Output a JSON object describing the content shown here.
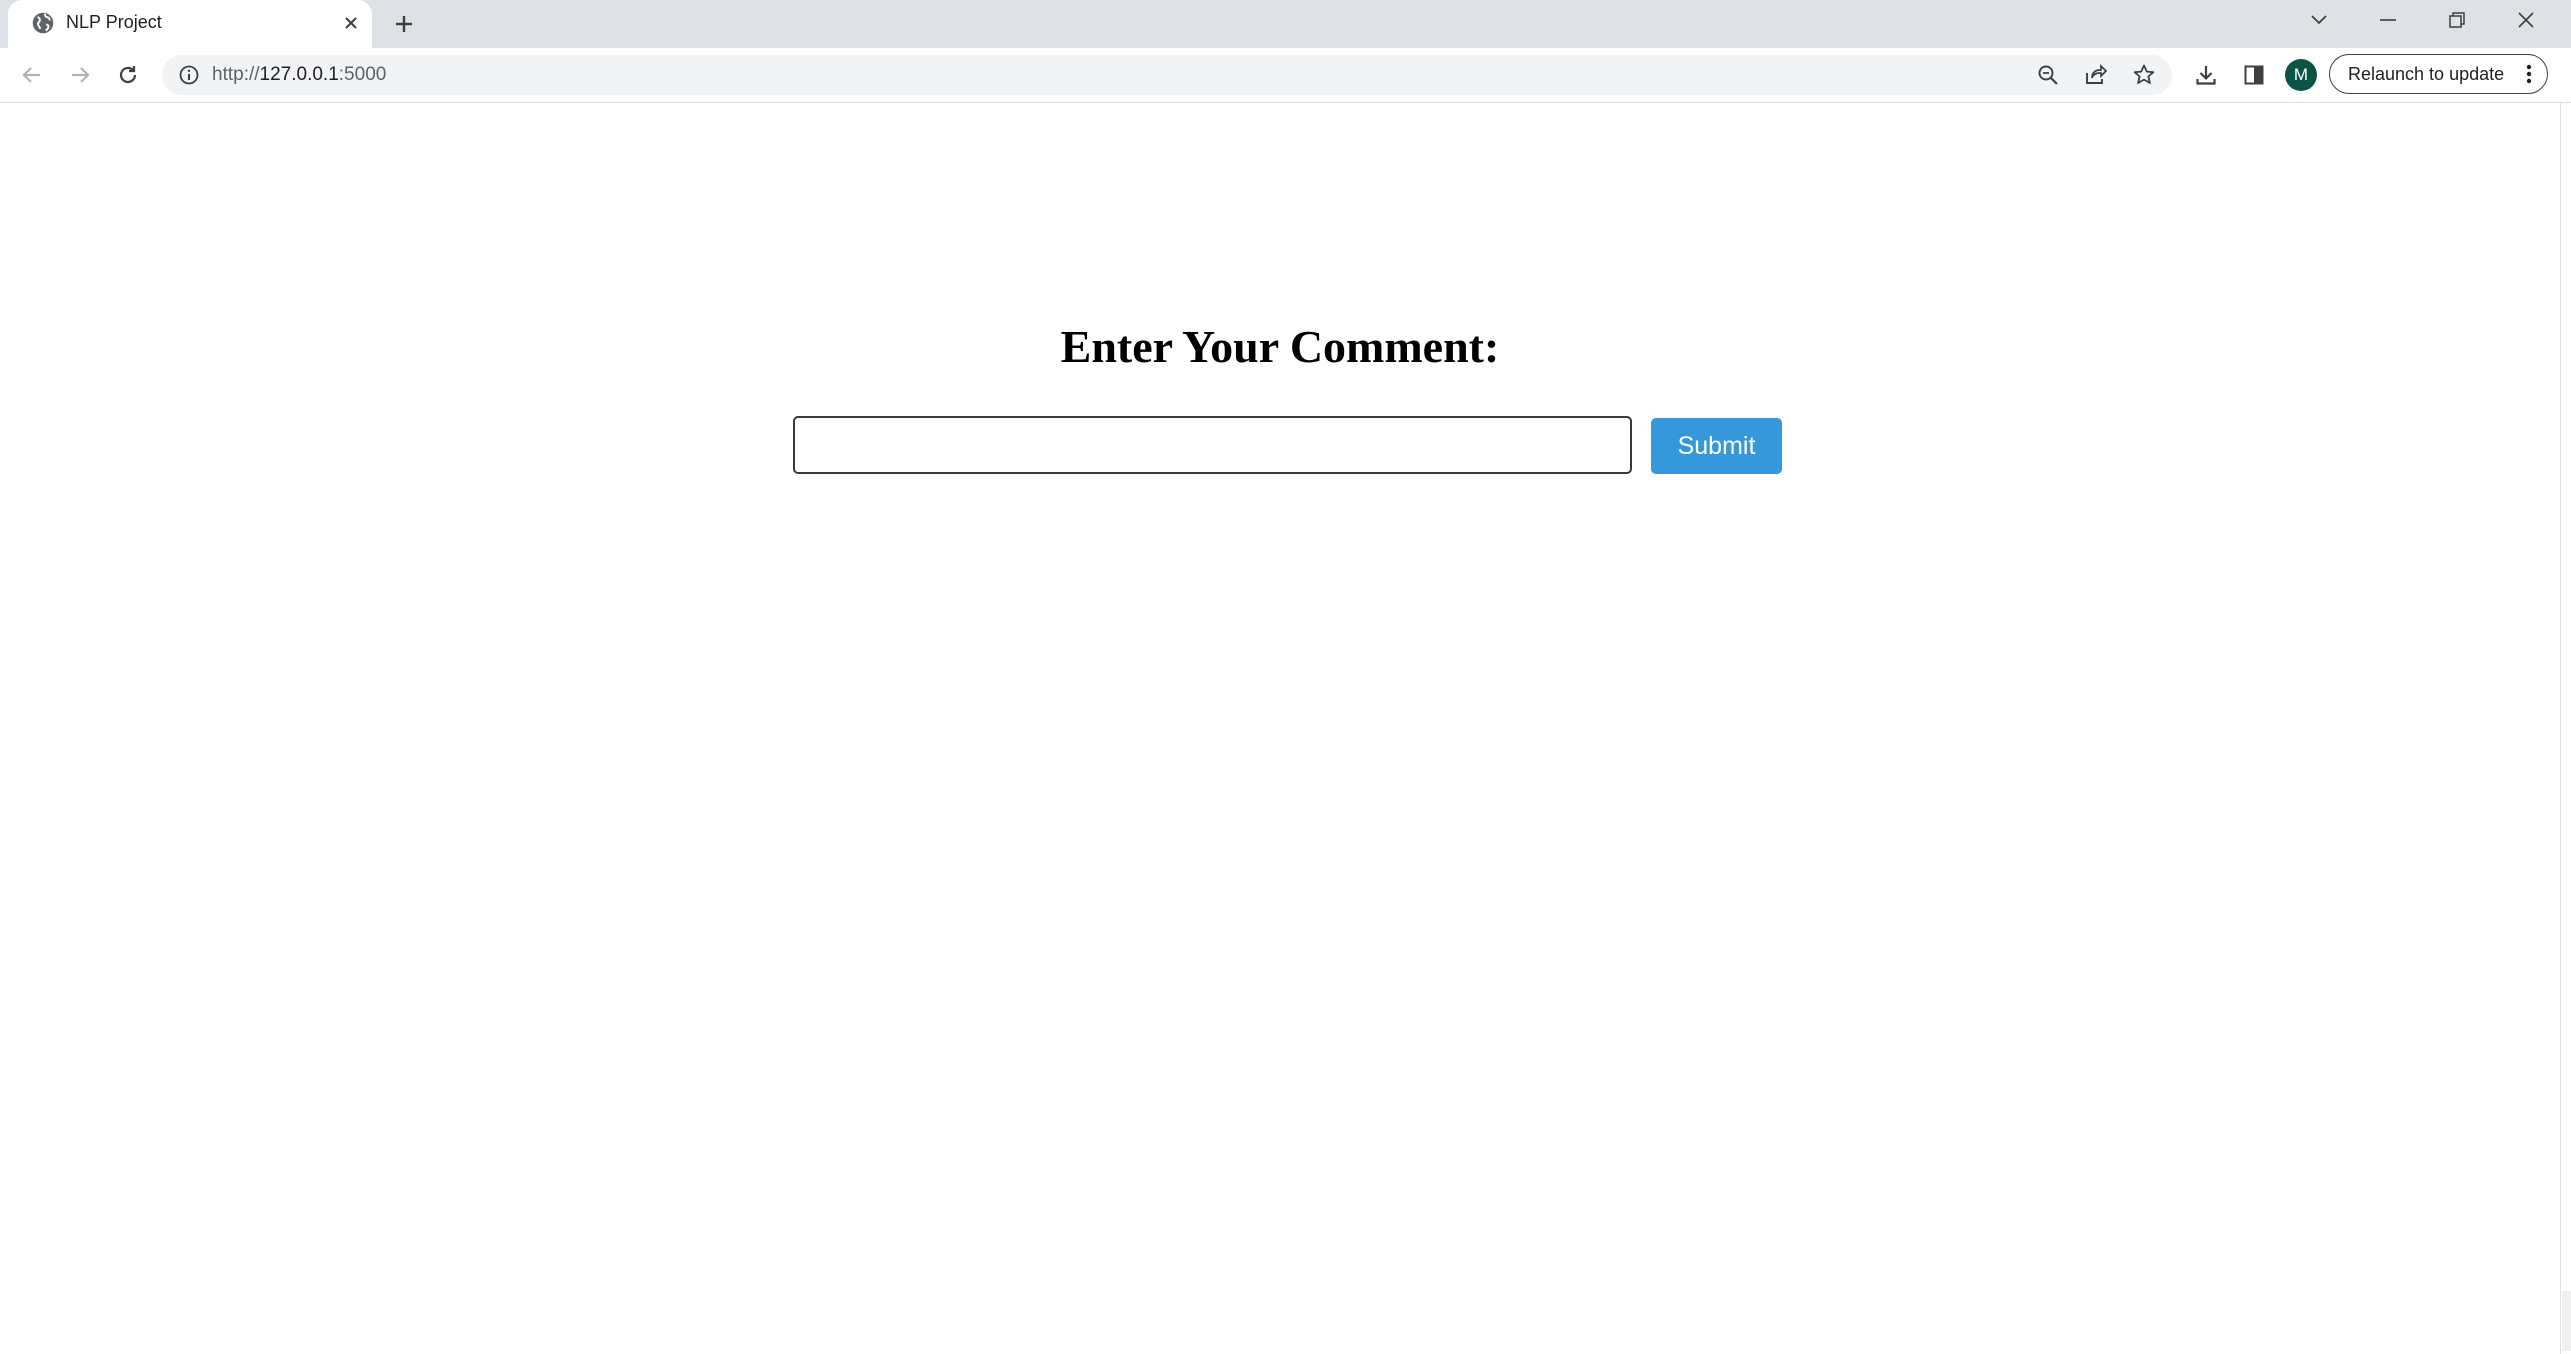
{
  "browser": {
    "tab": {
      "title": "NLP Project",
      "favicon": "globe-icon"
    },
    "new_tab_icon": "plus-icon",
    "window_controls": [
      "tab-search-icon",
      "minimize-icon",
      "restore-icon",
      "close-icon"
    ],
    "toolbar": {
      "back_icon": "back-arrow-icon",
      "forward_icon": "forward-arrow-icon",
      "reload_icon": "reload-icon",
      "url_scheme": "http://",
      "url_host": "127.0.0.1",
      "url_port": ":5000",
      "omnibox_icons": [
        "zoom-icon",
        "share-icon",
        "bookmark-star-icon"
      ],
      "action_icons": [
        "download-icon",
        "side-panel-icon"
      ],
      "profile_initial": "M",
      "relaunch_label": "Relaunch to update"
    }
  },
  "page": {
    "heading": "Enter Your Comment:",
    "comment_value": "",
    "comment_placeholder": "",
    "submit_label": "Submit",
    "accent_color": "#3498db"
  }
}
